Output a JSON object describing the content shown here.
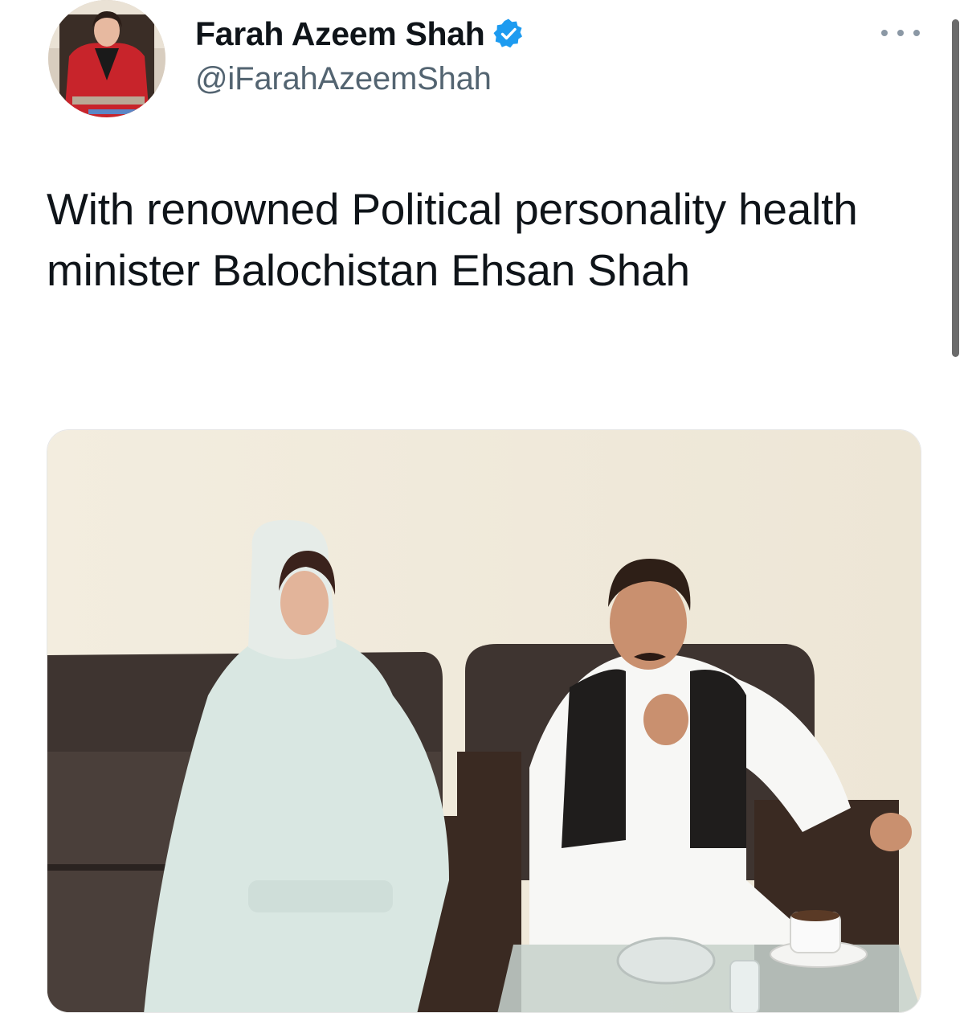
{
  "tweet": {
    "author": {
      "display_name": "Farah Azeem Shah",
      "handle": "@iFarahAzeemShah",
      "verified": true,
      "avatar_icon": "profile-photo"
    },
    "text": "With renowned Political personality health minister Balochistan Ehsan Shah",
    "media": {
      "type": "photo",
      "count": 1
    },
    "more_icon": "ellipsis-icon"
  },
  "colors": {
    "name": "#0f1419",
    "handle": "#536471",
    "verified": "#1d9bf0",
    "more_dots": "#8b98a5",
    "scrollbar": "#6b6b6b"
  }
}
